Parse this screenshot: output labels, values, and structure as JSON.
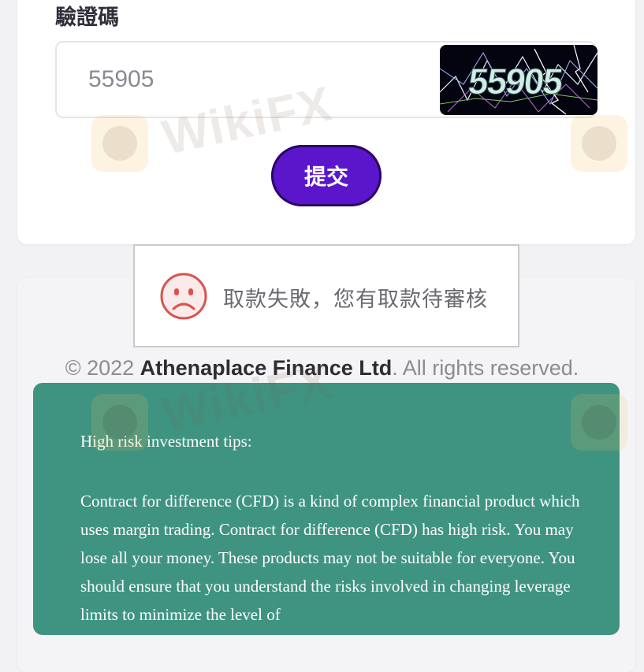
{
  "captcha": {
    "label": "驗證碼",
    "value": "55905",
    "image_text": "55905"
  },
  "submit": {
    "label": "提交"
  },
  "toast": {
    "icon": "sad-face-icon",
    "message": "取款失敗，您有取款待審核"
  },
  "footer": {
    "copyright_prefix": "© 2022 ",
    "company": "Athenaplace Finance Ltd",
    "copyright_suffix": ". All rights reserved."
  },
  "risk": {
    "title": "High risk investment tips:",
    "body": "Contract for difference (CFD) is a kind of complex financial product which uses margin trading. Contract for difference (CFD) has high risk. You may lose all your money. These products may not be suitable for everyone. You should ensure that you understand the risks involved in changing leverage limits to minimize the level of"
  },
  "watermark": {
    "text": "WikiFX"
  },
  "colors": {
    "submit_bg": "#5b16cc",
    "risk_bg": "#3f9381",
    "toast_icon": "#d9534f"
  }
}
